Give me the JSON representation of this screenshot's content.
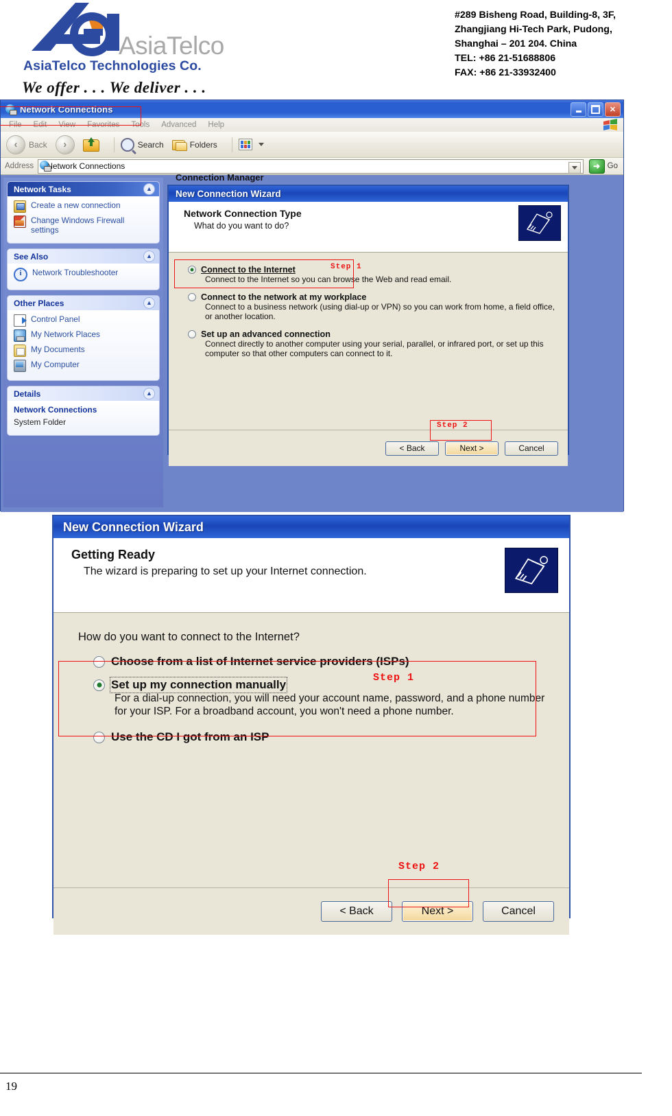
{
  "letterhead": {
    "brand_word": "AsiaTelco",
    "company": "AsiaTelco Technologies Co.",
    "tagline": "We offer . . . We deliver . . .",
    "address_lines": [
      "#289 Bisheng Road, Building-8, 3F,",
      "Zhangjiang Hi-Tech Park, Pudong,",
      "Shanghai – 201 204. China",
      "TEL: +86 21-51688806",
      "FAX: +86 21-33932400"
    ],
    "brand_color": "#2b4aa0"
  },
  "explorer": {
    "title": "Network Connections",
    "menu": [
      "File",
      "Edit",
      "View",
      "Favorites",
      "Tools",
      "Advanced",
      "Help"
    ],
    "toolbar": {
      "back_label": "Back",
      "search_label": "Search",
      "folders_label": "Folders"
    },
    "address": {
      "label": "Address",
      "value": "Network Connections",
      "go_label": "Go"
    },
    "window_buttons": {
      "minimize": "Minimize",
      "maximize": "Maximize",
      "close": "Close"
    },
    "task_panes": [
      {
        "title": "Network Tasks",
        "style": "dark",
        "items": [
          {
            "label": "Create a new connection",
            "icon": "new-connection-icon"
          },
          {
            "label": "Change Windows Firewall settings",
            "icon": "firewall-icon"
          }
        ]
      },
      {
        "title": "See Also",
        "style": "light",
        "items": [
          {
            "label": "Network Troubleshooter",
            "icon": "info-icon"
          }
        ]
      },
      {
        "title": "Other Places",
        "style": "light",
        "items": [
          {
            "label": "Control Panel",
            "icon": "control-panel-icon"
          },
          {
            "label": "My Network Places",
            "icon": "network-places-icon"
          },
          {
            "label": "My Documents",
            "icon": "documents-icon"
          },
          {
            "label": "My Computer",
            "icon": "computer-icon"
          }
        ]
      },
      {
        "title": "Details",
        "style": "light",
        "items": [
          {
            "label": "Network Connections",
            "icon": "none"
          },
          {
            "label": "System Folder",
            "icon": "none"
          }
        ]
      }
    ],
    "background_label": "Connection Manager"
  },
  "wizard1": {
    "title": "New Connection Wizard",
    "heading": "Network Connection Type",
    "subheading": "What do you want to do?",
    "options": [
      {
        "title": "Connect to the Internet",
        "description": "Connect to the Internet so you can browse the Web and read email.",
        "selected": true
      },
      {
        "title": "Connect to the network at my workplace",
        "description": "Connect to a business network (using dial-up or VPN) so you can work from home, a field office, or another location.",
        "selected": false
      },
      {
        "title": "Set up an advanced connection",
        "description": "Connect directly to another computer using your serial, parallel, or infrared port, or set up this computer so that other computers can connect to it.",
        "selected": false
      }
    ],
    "buttons": {
      "back": "< Back",
      "next": "Next >",
      "cancel": "Cancel"
    },
    "annotations": {
      "step1": "Step 1",
      "step2": "Step 2"
    }
  },
  "wizard2": {
    "title": "New Connection Wizard",
    "heading": "Getting Ready",
    "subheading": "The wizard is preparing to set up your Internet connection.",
    "question": "How do you want to connect to the Internet?",
    "options": [
      {
        "title": "Choose from a list of Internet service providers (ISPs)",
        "description": "",
        "selected": false
      },
      {
        "title": "Set up my connection manually",
        "description": "For a dial-up connection, you will need your account name, password, and a phone number for your ISP. For a broadband account, you won't need a phone number.",
        "selected": true
      },
      {
        "title": "Use the CD I got from an ISP",
        "description": "",
        "selected": false
      }
    ],
    "buttons": {
      "back": "< Back",
      "next": "Next >",
      "cancel": "Cancel"
    },
    "annotations": {
      "step1": "Step 1",
      "step2": "Step 2"
    }
  },
  "footer": {
    "page_number": "19"
  },
  "colors": {
    "annotation_red": "#ee1111",
    "titlebar_blue": "#1946b8",
    "task_blue": "#2a4fa0"
  }
}
